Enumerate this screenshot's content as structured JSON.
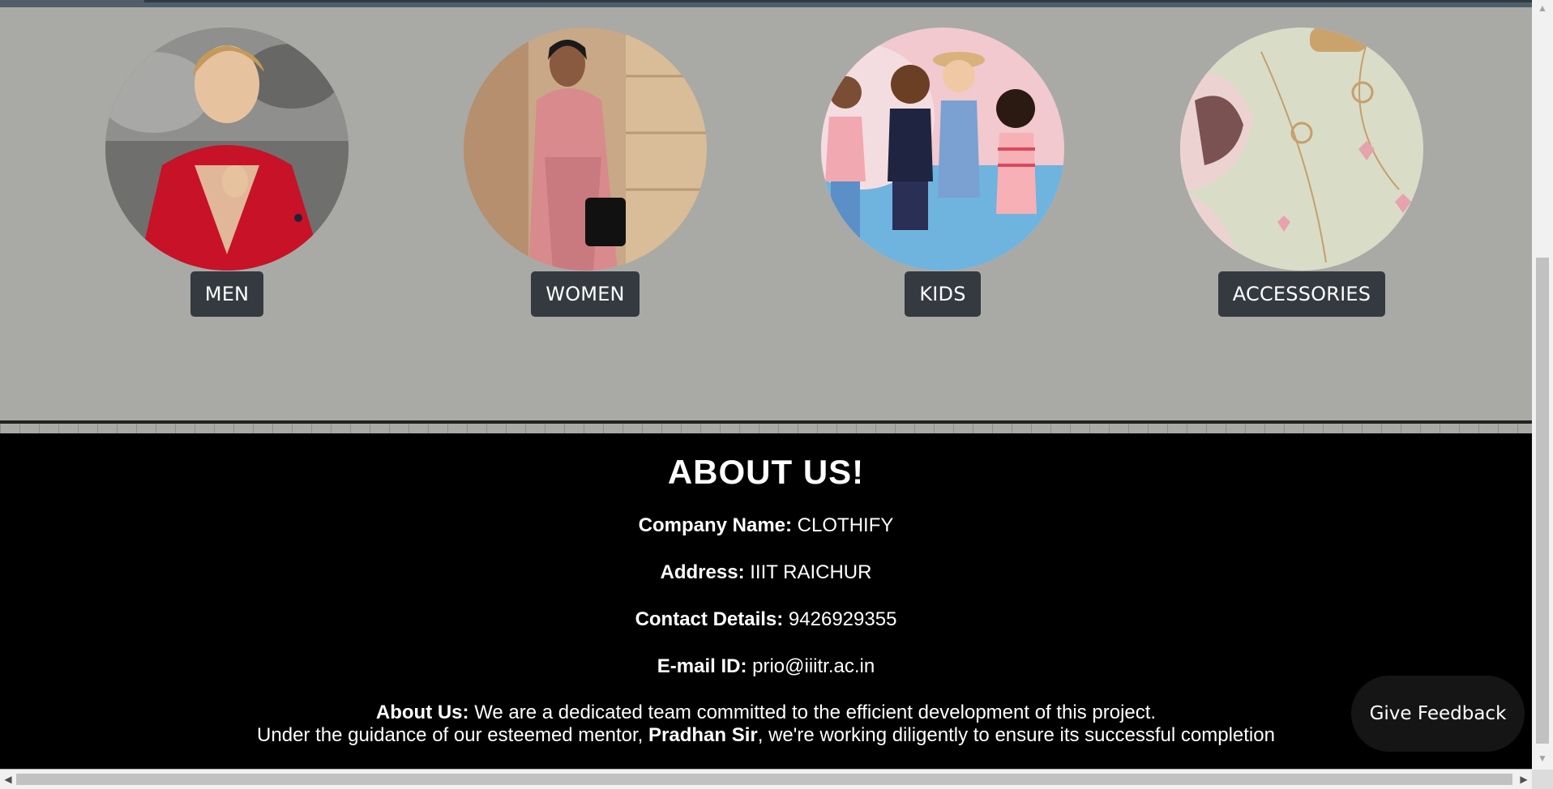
{
  "categories": [
    {
      "label": "MEN",
      "image": "man-in-red-suit-photo"
    },
    {
      "label": "WOMEN",
      "image": "woman-in-pink-suit-photo"
    },
    {
      "label": "KIDS",
      "image": "kids-group-photo"
    },
    {
      "label": "ACCESSORIES",
      "image": "jewelry-and-sunglasses-photo"
    }
  ],
  "about": {
    "heading": "ABOUT US!",
    "company_label": "Company Name:",
    "company_value": " CLOTHIFY",
    "address_label": "Address:",
    "address_value": " IIIT RAICHUR",
    "contact_label": "Contact Details:",
    "contact_value": " 9426929355",
    "email_label": "E-mail ID:",
    "email_value": " prio@iiitr.ac.in",
    "about_label": "About Us:",
    "about_text1": " We are a dedicated team committed to the efficient development of this project.",
    "about_text2a": "Under the guidance of our esteemed mentor, ",
    "mentor": "Pradhan Sir",
    "about_text2b": ", we're working diligently to ensure its successful completion"
  },
  "feedback": {
    "label": "Give Feedback"
  },
  "colors": {
    "page_bg": "#a9aaa5",
    "button_bg": "#343a40",
    "footer_bg": "#000000"
  }
}
